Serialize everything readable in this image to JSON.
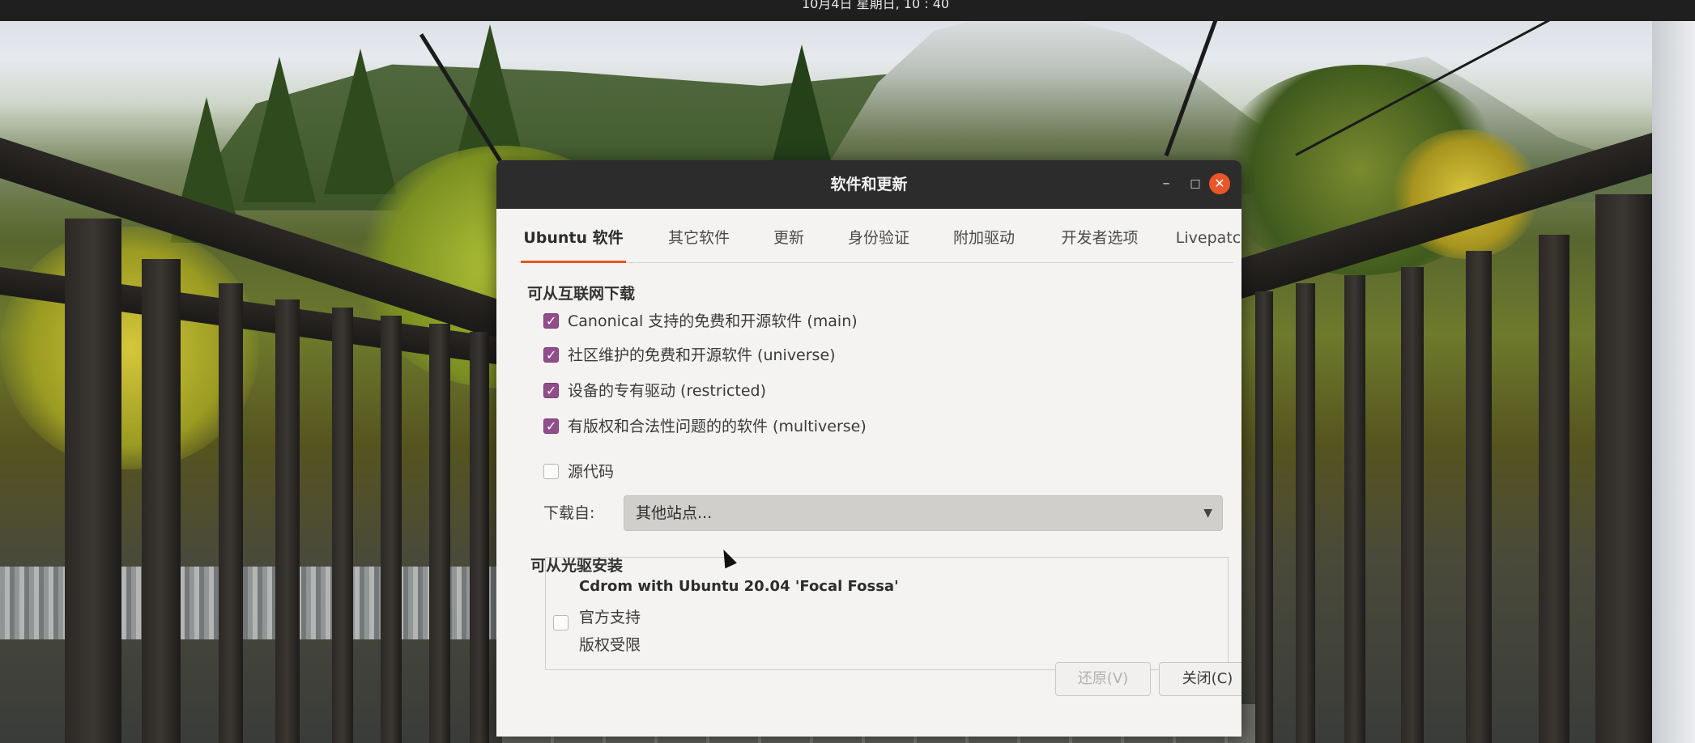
{
  "topbar": {
    "clock": "10月4日 星期日, 10 : 40"
  },
  "window": {
    "title": "软件和更新",
    "buttons": {
      "minimize": "–",
      "maximize": "□",
      "close": "✕"
    }
  },
  "tabs": [
    {
      "label": "Ubuntu 软件",
      "active": true
    },
    {
      "label": "其它软件",
      "active": false
    },
    {
      "label": "更新",
      "active": false
    },
    {
      "label": "身份验证",
      "active": false
    },
    {
      "label": "附加驱动",
      "active": false
    },
    {
      "label": "开发者选项",
      "active": false
    },
    {
      "label": "Livepatch",
      "active": false
    }
  ],
  "internet": {
    "title": "可从互联网下载",
    "options": [
      {
        "label": "Canonical 支持的免费和开源软件 (main)",
        "checked": true
      },
      {
        "label": "社区维护的免费和开源软件 (universe)",
        "checked": true
      },
      {
        "label": "设备的专有驱动 (restricted)",
        "checked": true
      },
      {
        "label": "有版权和合法性问题的的软件 (multiverse)",
        "checked": true
      },
      {
        "label": "源代码",
        "checked": false
      }
    ],
    "download_from_label": "下载自:",
    "download_from_value": "其他站点..."
  },
  "cdrom": {
    "title": "可从光驱安装",
    "name": "Cdrom with Ubuntu 20.04 'Focal Fossa'",
    "line1": "官方支持",
    "line2": "版权受限",
    "checked": false
  },
  "footer": {
    "revert_label": "还原(V)",
    "close_label": "关闭(C)"
  },
  "colors": {
    "accent": "#e95420",
    "checkbox_checked": "#924d8b",
    "titlebar": "#2c2c2c"
  }
}
